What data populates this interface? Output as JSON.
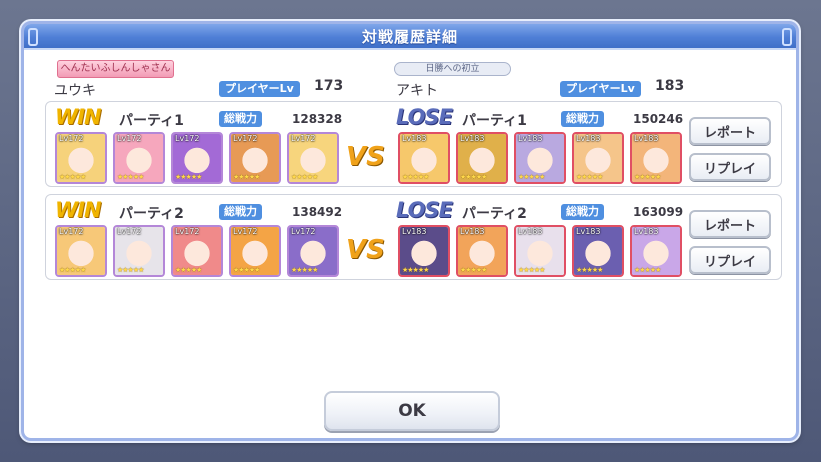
{
  "dialog": {
    "title": "対戦履歴詳細",
    "ok_label": "OK"
  },
  "player_left": {
    "name_tag": "へんたいふしんしゃさん",
    "name": "ユウキ",
    "level_label": "プレイヤーLv",
    "level": "173"
  },
  "player_right": {
    "rank_tag": "日勝への初立",
    "name": "アキト",
    "level_label": "プレイヤーLv",
    "level": "183"
  },
  "matches": [
    {
      "left": {
        "result": "WIN",
        "party": "パーティ1",
        "power_label": "総戦力",
        "power": "128328",
        "units": [
          {
            "lv": "Lv172",
            "color": "#f6d27b"
          },
          {
            "lv": "Lv172",
            "color": "#f6a7bd"
          },
          {
            "lv": "Lv172",
            "color": "#a36ad6"
          },
          {
            "lv": "Lv172",
            "color": "#e79a55"
          },
          {
            "lv": "Lv172",
            "color": "#f7d57d"
          }
        ]
      },
      "vs": "VS",
      "right": {
        "result": "LOSE",
        "party": "パーティ1",
        "power_label": "総戦力",
        "power": "150246",
        "units": [
          {
            "lv": "Lv183",
            "color": "#f6c86b"
          },
          {
            "lv": "Lv183",
            "color": "#e0b04a"
          },
          {
            "lv": "Lv183",
            "color": "#b9a9e0"
          },
          {
            "lv": "Lv183",
            "color": "#f5c58a"
          },
          {
            "lv": "Lv183",
            "color": "#f3b57a"
          }
        ]
      },
      "report_label": "レポート",
      "replay_label": "リプレイ"
    },
    {
      "left": {
        "result": "WIN",
        "party": "パーティ2",
        "power_label": "総戦力",
        "power": "138492",
        "units": [
          {
            "lv": "Lv172",
            "color": "#f7c878"
          },
          {
            "lv": "Lv172",
            "color": "#e7e4ea"
          },
          {
            "lv": "Lv172",
            "color": "#f08a8a"
          },
          {
            "lv": "Lv172",
            "color": "#f4a445"
          },
          {
            "lv": "Lv172",
            "color": "#8a6dc9"
          }
        ]
      },
      "vs": "VS",
      "right": {
        "result": "LOSE",
        "party": "パーティ2",
        "power_label": "総戦力",
        "power": "163099",
        "units": [
          {
            "lv": "Lv183",
            "color": "#5b4c8a"
          },
          {
            "lv": "Lv183",
            "color": "#f2a45a"
          },
          {
            "lv": "Lv183",
            "color": "#e8e0ec"
          },
          {
            "lv": "Lv183",
            "color": "#6b5fb0"
          },
          {
            "lv": "Lv183",
            "color": "#c9a7e8"
          }
        ]
      },
      "report_label": "レポート",
      "replay_label": "リプレイ"
    }
  ],
  "stars": "★★★★★"
}
